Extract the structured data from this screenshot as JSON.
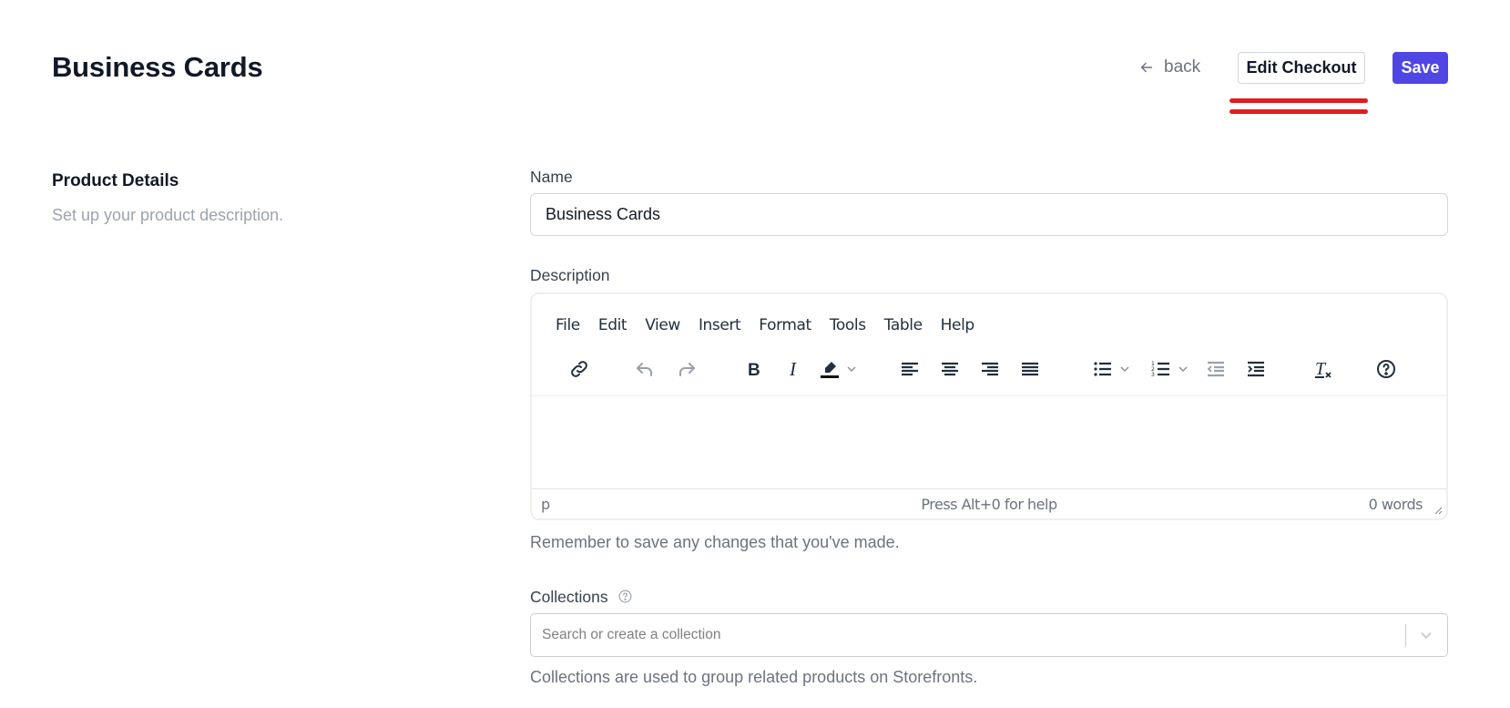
{
  "header": {
    "title": "Business Cards",
    "back_label": "back",
    "edit_checkout_label": "Edit Checkout",
    "save_label": "Save"
  },
  "colors": {
    "primary": "#4f46e5",
    "annotation": "#e11d22"
  },
  "section": {
    "title": "Product Details",
    "subtitle": "Set up your product description."
  },
  "form": {
    "name": {
      "label": "Name",
      "value": "Business Cards"
    },
    "description": {
      "label": "Description",
      "menubar": [
        "File",
        "Edit",
        "View",
        "Insert",
        "Format",
        "Tools",
        "Table",
        "Help"
      ],
      "toolbar_icons": [
        "link-icon",
        "undo-icon",
        "redo-icon",
        "bold-icon",
        "italic-icon",
        "highlight-color-icon",
        "align-left-icon",
        "align-center-icon",
        "align-right-icon",
        "align-justify-icon",
        "bullet-list-icon",
        "numbered-list-icon",
        "outdent-icon",
        "indent-icon",
        "clear-formatting-icon",
        "help-icon"
      ],
      "status_path": "p",
      "status_help": "Press Alt+0 for help",
      "word_count": "0 words",
      "helper": "Remember to save any changes that you've made."
    },
    "collections": {
      "label": "Collections",
      "placeholder": "Search or create a collection",
      "helper": "Collections are used to group related products on Storefronts."
    }
  }
}
